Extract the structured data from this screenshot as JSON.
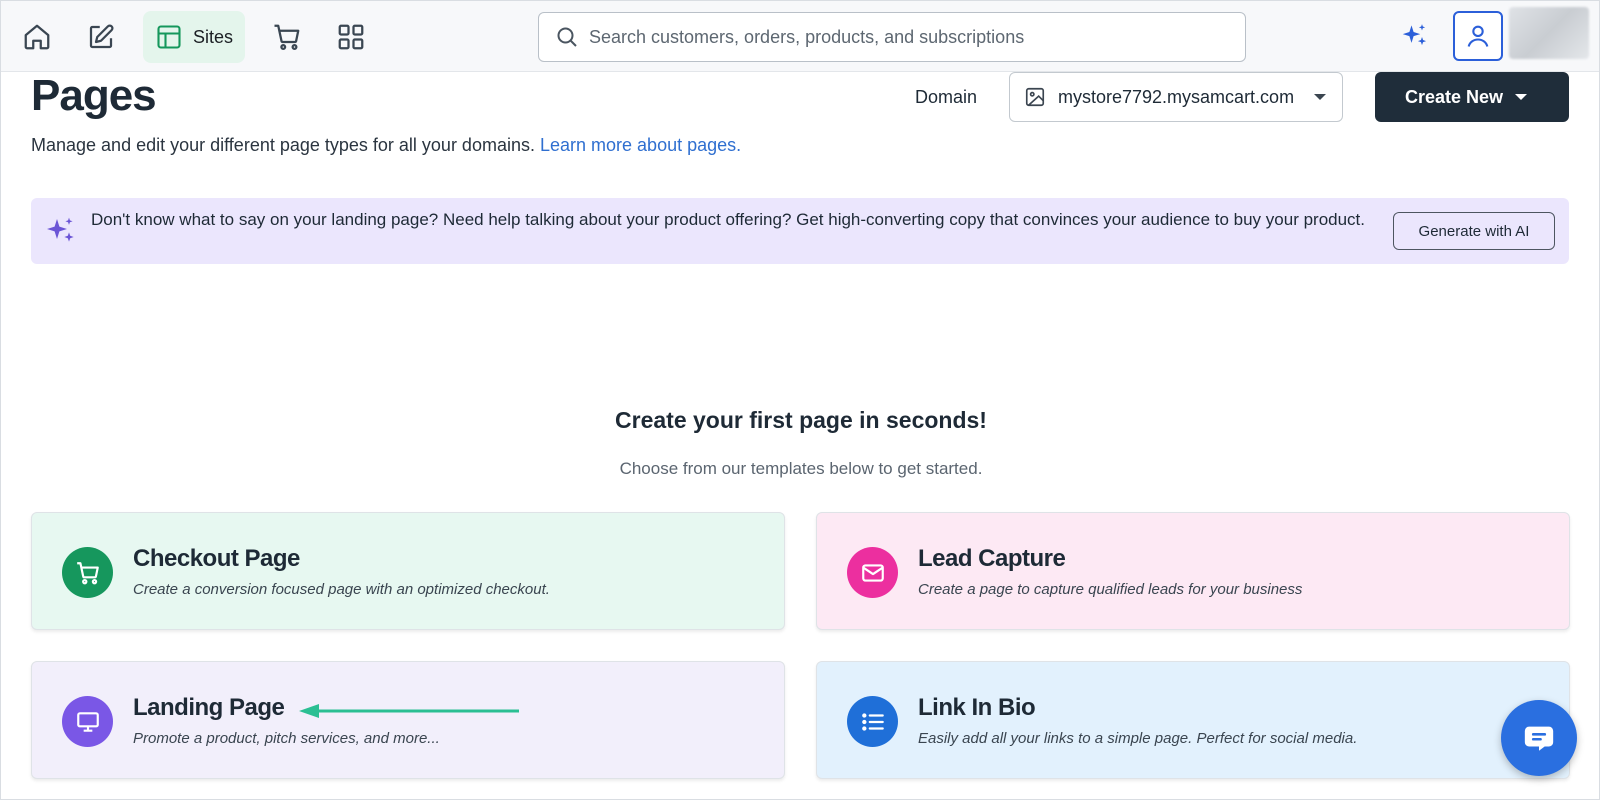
{
  "nav": {
    "sites_label": "Sites",
    "search_placeholder": "Search customers, orders, products, and subscriptions"
  },
  "header": {
    "title": "Pages",
    "subtitle": "Manage and edit your different page types for all your domains.",
    "learn_more": "Learn more about pages.",
    "domain_label": "Domain",
    "domain_value": "mystore7792.mysamcart.com",
    "create_new": "Create New"
  },
  "banner": {
    "text": "Don't know what to say on your landing page? Need help talking about your product offering? Get high-converting copy that convinces your audience to buy your product.",
    "button": "Generate with AI"
  },
  "empty_state": {
    "title": "Create your first page in seconds!",
    "subtitle": "Choose from our templates below to get started."
  },
  "templates": [
    {
      "title": "Checkout Page",
      "description": "Create a conversion focused page with an optimized checkout.",
      "icon": "cart-icon",
      "color": "#16975d"
    },
    {
      "title": "Lead Capture",
      "description": "Create a page to capture qualified leads for your business",
      "icon": "mail-icon",
      "color": "#ec2f9f"
    },
    {
      "title": "Landing Page",
      "description": "Promote a product, pitch services, and more...",
      "icon": "monitor-icon",
      "color": "#7a57e6"
    },
    {
      "title": "Link In Bio",
      "description": "Easily add all your links to a simple page. Perfect for social media.",
      "icon": "list-icon",
      "color": "#1f6fd8"
    }
  ],
  "colors": {
    "accent": "#2b5fd9",
    "primary_button": "#1f2d3a",
    "arrow": "#2bbf93"
  }
}
